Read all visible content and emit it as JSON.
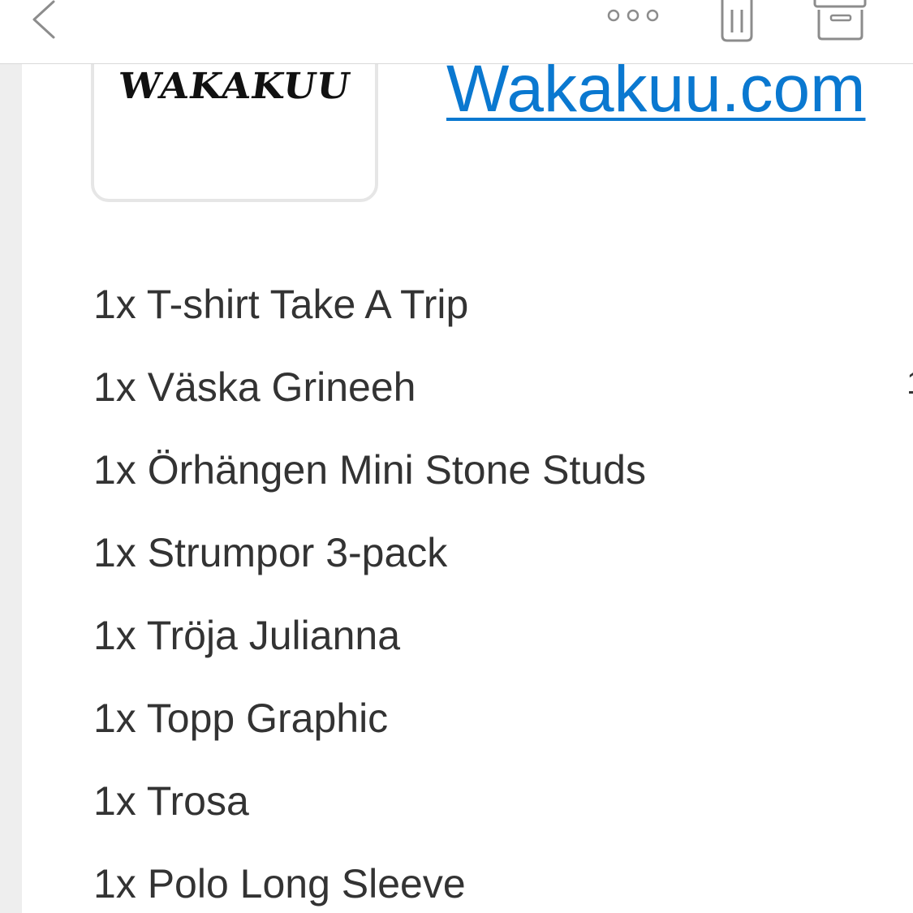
{
  "toolbar": {
    "back_icon": "chevron-left-icon",
    "more_icon": "more-dots-icon",
    "trash_icon": "trash-icon",
    "archive_icon": "archive-icon",
    "icon_color": "#8c8c8c"
  },
  "email": {
    "logo_text": "WAKAKUU",
    "site_link": "Wakakuu.com",
    "link_color": "#0a78d0",
    "text_color": "#333333",
    "items": [
      "1x T-shirt Take A Trip",
      "1x Väska Grineeh",
      "1x Örhängen Mini Stone Studs",
      "1x Strumpor 3-pack",
      "1x Tröja Julianna",
      "1x Topp Graphic",
      "1x Trosa",
      "1x Polo Long Sleeve"
    ]
  }
}
